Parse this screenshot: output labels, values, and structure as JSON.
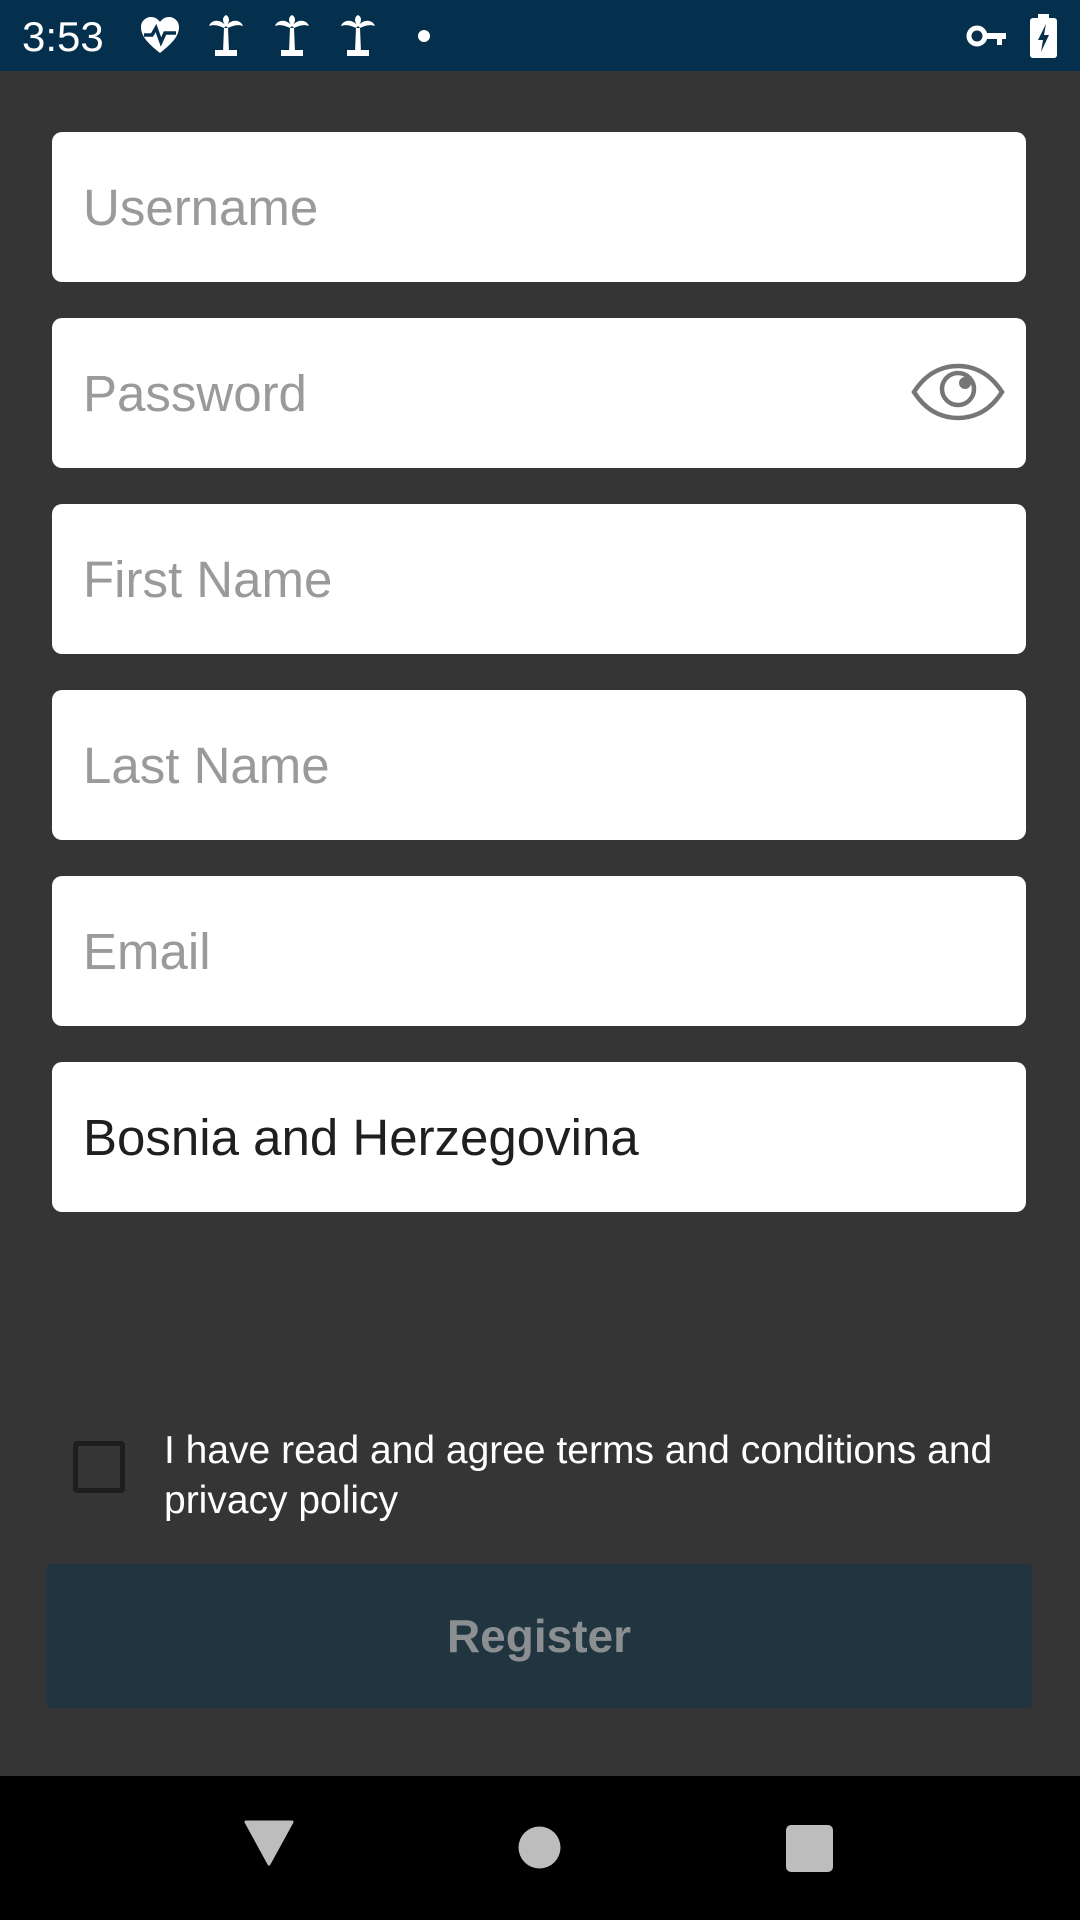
{
  "status_bar": {
    "time": "3:53",
    "left_icons": [
      "heart-pulse-icon",
      "palm-tree-icon",
      "palm-tree-icon",
      "palm-tree-icon",
      "dot-icon"
    ],
    "right_icons": [
      "vpn-key-icon",
      "battery-charging-icon"
    ]
  },
  "form": {
    "username": {
      "placeholder": "Username",
      "value": ""
    },
    "password": {
      "placeholder": "Password",
      "value": ""
    },
    "first_name": {
      "placeholder": "First Name",
      "value": ""
    },
    "last_name": {
      "placeholder": "Last Name",
      "value": ""
    },
    "email": {
      "placeholder": "Email",
      "value": ""
    },
    "country": {
      "value": "Bosnia and Herzegovina"
    }
  },
  "terms": {
    "checked": false,
    "label": "I have read and agree terms and conditions and privacy policy"
  },
  "register_button": {
    "label": "Register"
  },
  "colors": {
    "status_bar": "#04304e",
    "background": "#353535",
    "field": "#ffffff",
    "button": "#213541",
    "button_text": "#8b8f92",
    "nav_bar": "#000000"
  }
}
